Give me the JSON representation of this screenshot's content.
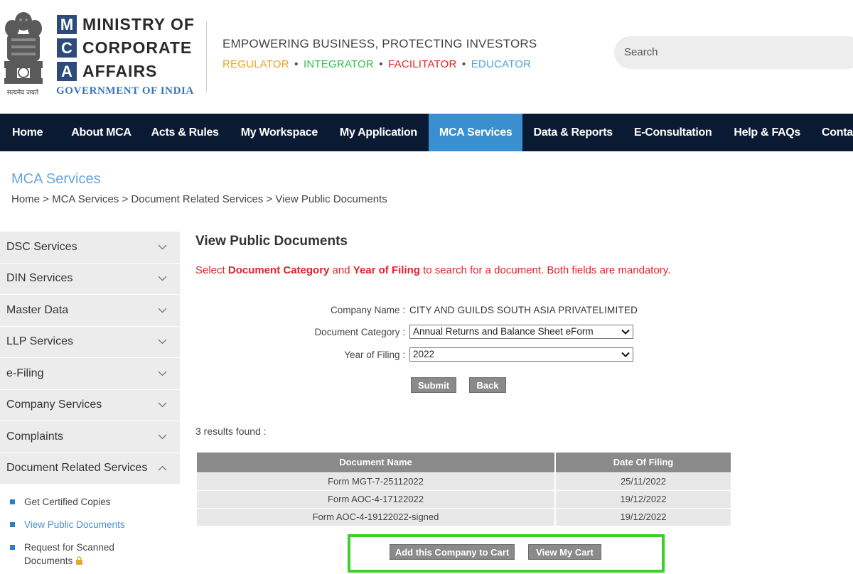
{
  "header": {
    "logo_letters": [
      "M",
      "C",
      "A"
    ],
    "logo_words": [
      "MINISTRY OF",
      "CORPORATE",
      "AFFAIRS"
    ],
    "government": "GOVERNMENT OF INDIA",
    "emblem_caption": "सत्यमेव जयते",
    "tagline": "EMPOWERING BUSINESS, PROTECTING INVESTORS",
    "roles": [
      {
        "label": "REGULATOR",
        "color": "#f0a020"
      },
      {
        "label": "INTEGRATOR",
        "color": "#2fbf4a"
      },
      {
        "label": "FACILITATOR",
        "color": "#e0232b"
      },
      {
        "label": "EDUCATOR",
        "color": "#4aa3df"
      }
    ],
    "role_separator": "•",
    "search_placeholder": "Search"
  },
  "nav": {
    "items": [
      "Home",
      "About MCA",
      "Acts & Rules",
      "My Workspace",
      "My Application",
      "MCA Services",
      "Data & Reports",
      "E-Consultation",
      "Help & FAQs",
      "Contact"
    ],
    "active": "MCA Services"
  },
  "page": {
    "section_title": "MCA Services",
    "breadcrumb": "Home > MCA Services > Document Related Services > View Public Documents"
  },
  "sidebar": {
    "items": [
      "DSC Services",
      "DIN Services",
      "Master Data",
      "LLP Services",
      "e-Filing",
      "Company Services",
      "Complaints",
      "Document Related Services"
    ],
    "sub_items": [
      "Get Certified Copies",
      "View Public Documents",
      "Request for Scanned Documents"
    ],
    "active_sub": "View Public Documents"
  },
  "main": {
    "title": "View Public Documents",
    "instruction_prefix": "Select ",
    "instruction_bold1": "Document Category",
    "instruction_mid": " and ",
    "instruction_bold2": "Year of Filing",
    "instruction_suffix": " to search for a document. Both fields are mandatory.",
    "company_label": "Company Name :",
    "company_value": "CITY AND GUILDS SOUTH ASIA PRIVATELIMITED",
    "category_label": "Document Category :",
    "category_value": "Annual Returns and Balance Sheet eForm",
    "year_label": "Year of Filing :",
    "year_value": "2022",
    "submit_label": "Submit",
    "back_label": "Back",
    "results_text": "3  results found :",
    "table": {
      "headers": [
        "Document Name",
        "Date Of Filing"
      ],
      "rows": [
        [
          "Form MGT-7-25112022",
          "25/11/2022"
        ],
        [
          "Form AOC-4-17122022",
          "19/12/2022"
        ],
        [
          "Form AOC-4-19122022-signed",
          "19/12/2022"
        ]
      ]
    },
    "add_cart_label": "Add this Company to Cart",
    "view_cart_label": "View My Cart"
  }
}
